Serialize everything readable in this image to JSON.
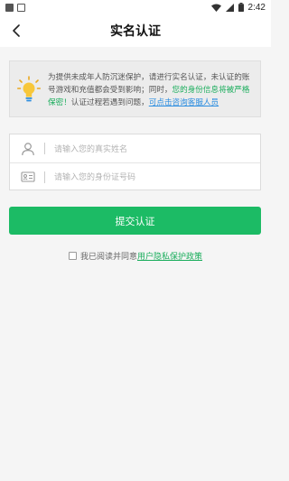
{
  "status_bar": {
    "time": "2:42"
  },
  "nav": {
    "title": "实名认证"
  },
  "notice": {
    "text_part1": "为提供未成年人防沉迷保护，请进行实名认证，未认证的账号游戏和充值都会受到影响；同时，",
    "text_green": "您的身份信息将被严格保密！",
    "text_part2": "认证过程若遇到问题，",
    "link_text": "可点击咨询客服人员"
  },
  "form": {
    "name_placeholder": "请输入您的真实姓名",
    "id_placeholder": "请输入您的身份证号码"
  },
  "submit": {
    "label": "提交认证"
  },
  "agreement": {
    "prefix": "我已阅读并同意",
    "link": "用户隐私保护政策"
  },
  "colors": {
    "accent_green": "#1cbb65",
    "link_blue": "#2b8de0",
    "notice_bg": "#ececec"
  },
  "icons": {
    "back": "chevron-left-icon",
    "notice": "lightbulb-icon",
    "name_field": "user-icon",
    "id_field": "id-card-icon"
  }
}
